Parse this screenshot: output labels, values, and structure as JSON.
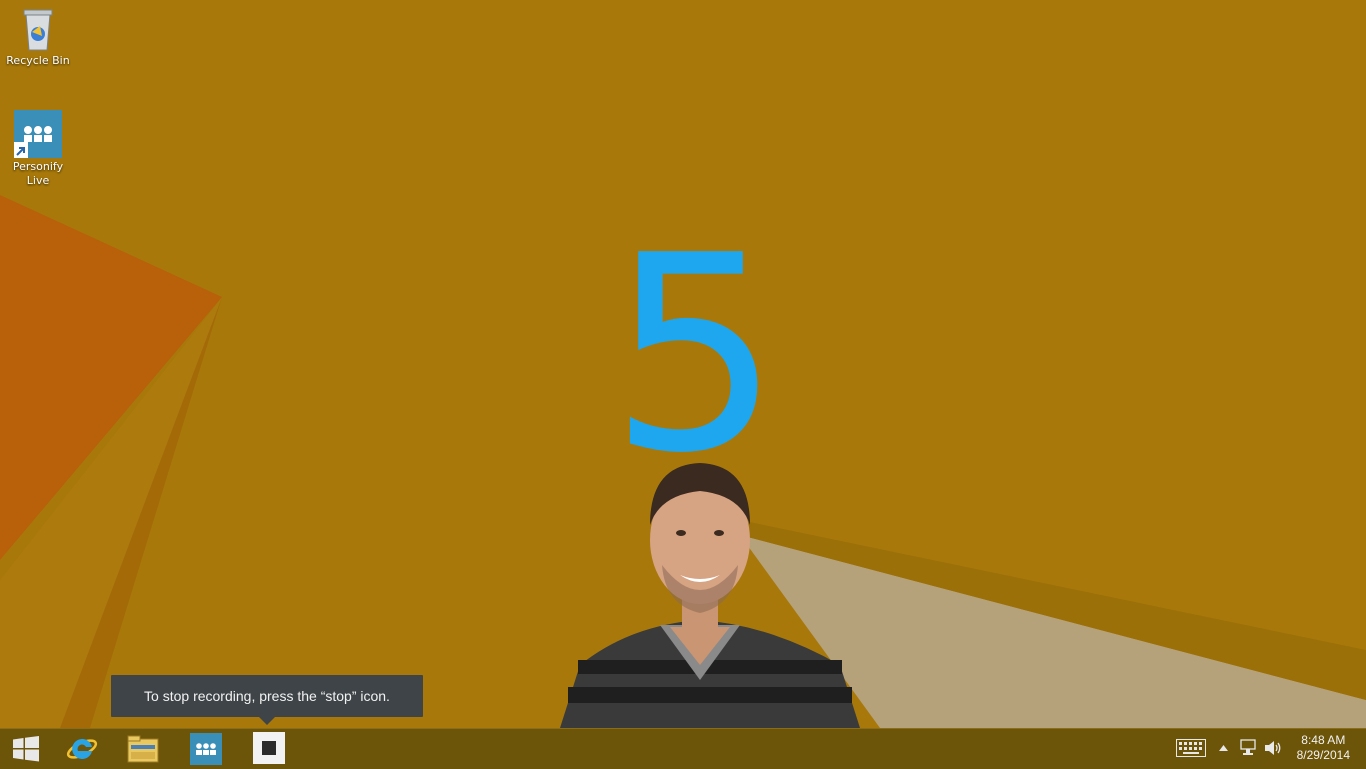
{
  "desktop": {
    "icons": [
      {
        "label": "Recycle Bin",
        "icon": "recycle-bin-icon"
      },
      {
        "label": "Personify Live",
        "icon": "personify-live-icon"
      }
    ]
  },
  "overlay": {
    "countdown": "5",
    "countdown_color": "#1ea7ef"
  },
  "tooltip": {
    "text": "To stop recording, press the “stop” icon."
  },
  "taskbar": {
    "buttons": [
      {
        "icon": "windows-start-icon"
      },
      {
        "icon": "internet-explorer-icon"
      },
      {
        "icon": "file-explorer-icon"
      },
      {
        "icon": "personify-live-icon"
      },
      {
        "icon": "stop-recording-icon"
      }
    ],
    "tray": {
      "icons": [
        "keyboard-icon",
        "show-hidden-icons-chevron",
        "network-icon",
        "volume-icon"
      ],
      "time": "8:48 AM",
      "date": "8/29/2014"
    }
  },
  "colors": {
    "wallpaper_base": "#a8790a",
    "taskbar": "#6c5409",
    "tooltip_bg": "#3e4447"
  }
}
